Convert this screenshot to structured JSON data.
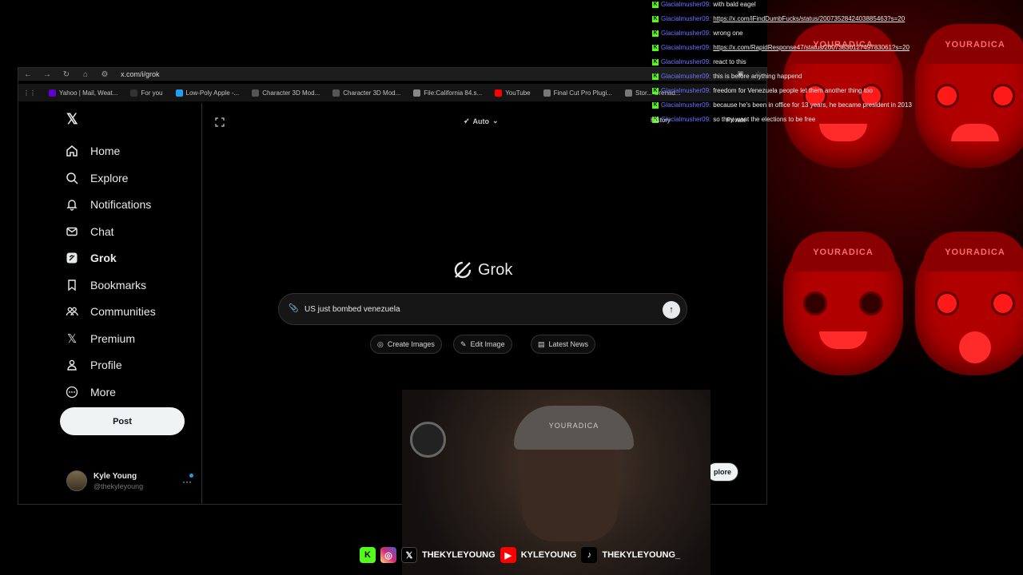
{
  "browser": {
    "url": "x.com/i/grok",
    "bookmarks": [
      {
        "label": "Yahoo | Mail, Weat...",
        "color": "#6001d2"
      },
      {
        "label": "For you",
        "color": "#000000"
      },
      {
        "label": "Low-Poly Apple -...",
        "color": "#1da1f2"
      },
      {
        "label": "Character 3D Mod...",
        "color": "#555555"
      },
      {
        "label": "Character 3D Mod...",
        "color": "#555555"
      },
      {
        "label": "File:California 84.s...",
        "color": "#888888"
      },
      {
        "label": "YouTube",
        "color": "#ff0000"
      },
      {
        "label": "Final Cut Pro Plugi...",
        "color": "#777777"
      },
      {
        "label": "Stor... Grenad...",
        "color": "#777777"
      }
    ],
    "right_tools": {
      "history": "History",
      "private": "Private"
    }
  },
  "sidebar": {
    "items": [
      {
        "label": "Home",
        "icon": "home-icon"
      },
      {
        "label": "Explore",
        "icon": "search-icon"
      },
      {
        "label": "Notifications",
        "icon": "bell-icon"
      },
      {
        "label": "Chat",
        "icon": "mail-icon"
      },
      {
        "label": "Grok",
        "icon": "grok-icon"
      },
      {
        "label": "Bookmarks",
        "icon": "bookmark-icon"
      },
      {
        "label": "Communities",
        "icon": "communities-icon"
      },
      {
        "label": "Premium",
        "icon": "x-icon"
      },
      {
        "label": "Profile",
        "icon": "person-icon"
      },
      {
        "label": "More",
        "icon": "more-icon"
      }
    ],
    "post_label": "Post",
    "profile": {
      "name": "Kyle Young",
      "handle": "@thekyleyoung",
      "more": "···"
    }
  },
  "grok": {
    "model": "Auto",
    "title": "Grok",
    "prompt_value": "US just bombed venezuela",
    "chips": [
      "Create Images",
      "Edit Image",
      "Latest News"
    ],
    "explore_label": "plore"
  },
  "chat": [
    {
      "user": "Glacialmusher09:",
      "msg": "with bald eagel",
      "link": false
    },
    {
      "user": "Glacialmusher09:",
      "msg": "https://x.com/iFindDumbFucks/status/2007352842403885463?s=20",
      "link": true
    },
    {
      "user": "Glacialmusher09:",
      "msg": "wrong one",
      "link": false
    },
    {
      "user": "Glacialmusher09:",
      "msg": "https://x.com/RapidResponse47/status/2007383012749783061?s=20",
      "link": true
    },
    {
      "user": "Glacialmusher09:",
      "msg": "react to this",
      "link": false
    },
    {
      "user": "Glacialmusher09:",
      "msg": "this is before anything happend",
      "link": false
    },
    {
      "user": "Glacialmusher09:",
      "msg": "freedom for Venezuela people let them another thing too",
      "link": false
    },
    {
      "user": "Glacialmusher09:",
      "msg": "because he's been in office for 13 years, he became president in 2013",
      "link": false
    },
    {
      "user": "Glacialmusher09:",
      "msg": "so they want the elections to be free",
      "link": false
    }
  ],
  "overlay": {
    "cap_text": "YOURADICA"
  },
  "webcam": {
    "hat_text": "YOURADICA"
  },
  "social": [
    {
      "icon": "kick-icon",
      "label": "",
      "color": "#53fc18"
    },
    {
      "icon": "instagram-icon",
      "label": "",
      "color": "#d62976"
    },
    {
      "icon": "x-icon",
      "label": "THEKYLEYOUNG",
      "color": "#000000"
    },
    {
      "icon": "youtube-icon",
      "label": "KYLEYOUNG",
      "color": "#ff0000"
    },
    {
      "icon": "tiktok-icon",
      "label": "THEKYLEYOUNG_",
      "color": "#000000"
    }
  ]
}
